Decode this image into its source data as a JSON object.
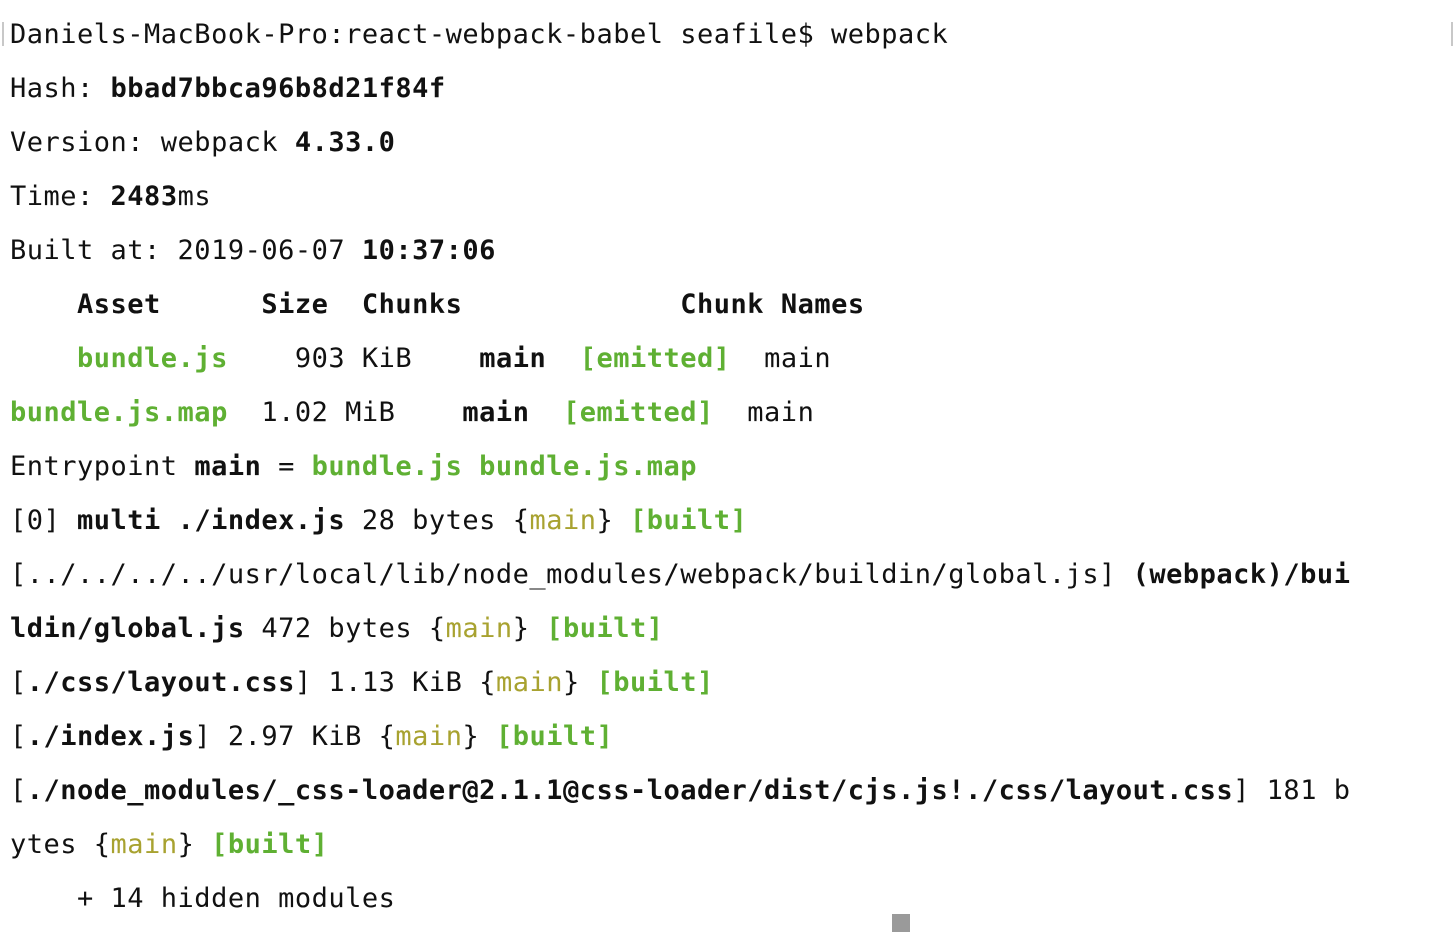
{
  "terminal": {
    "prompt": "Daniels-MacBook-Pro:react-webpack-babel seafile$ ",
    "command": "webpack",
    "hash_label": "Hash: ",
    "hash_value": "bbad7bbca96b8d21f84f",
    "version_label": "Version: webpack ",
    "version_value": "4.33.0",
    "time_label": "Time: ",
    "time_value": "2483",
    "time_unit": "ms",
    "built_label": "Built at: 2019-06-07 ",
    "built_time": "10:37:06",
    "table": {
      "headers": [
        "Asset",
        "Size",
        "Chunks",
        "Chunk Names"
      ],
      "rows": [
        {
          "asset": "bundle.js",
          "size": "903 KiB",
          "chunks": "main",
          "status": "[emitted]",
          "names": "main"
        },
        {
          "asset": "bundle.js.map",
          "size": "1.02 MiB",
          "chunks": "main",
          "status": "[emitted]",
          "names": "main"
        }
      ]
    },
    "entrypoint": {
      "label": "Entrypoint ",
      "name": "main",
      "eq": " = ",
      "files": "bundle.js bundle.js.map"
    },
    "modules": [
      {
        "pre": "[0] ",
        "bold": "multi ./index.js",
        "size": " 28 bytes ",
        "chunk": "main",
        "built": "[built]"
      },
      {
        "pre": "[../../../../usr/local/lib/node_modules/webpack/buildin/global.js] ",
        "bold": "(webpack)/bui",
        "bold2": "ldin/global.js",
        "size": " 472 bytes ",
        "chunk": "main",
        "built": "[built]"
      },
      {
        "pre": "[",
        "bold": "./css/layout.css",
        "post": "]",
        "size": " 1.13 KiB ",
        "chunk": "main",
        "built": "[built]"
      },
      {
        "pre": "[",
        "bold": "./index.js",
        "post": "]",
        "size": " 2.97 KiB ",
        "chunk": "main",
        "built": "[built]"
      },
      {
        "pre": "[",
        "bold": "./node_modules/_css-loader@2.1.1@css-loader/dist/cjs.js!./css/layout.css",
        "post": "]",
        "size": " 181 b",
        "size2": "ytes ",
        "chunk": "main",
        "built": "[built]"
      }
    ],
    "hidden_modules": "    + 14 hidden modules",
    "open_brace": "{",
    "close_brace": "}"
  },
  "colors": {
    "green": "#5fb033",
    "yellow": "#a8a230",
    "text": "#111111",
    "background": "#ffffff"
  }
}
